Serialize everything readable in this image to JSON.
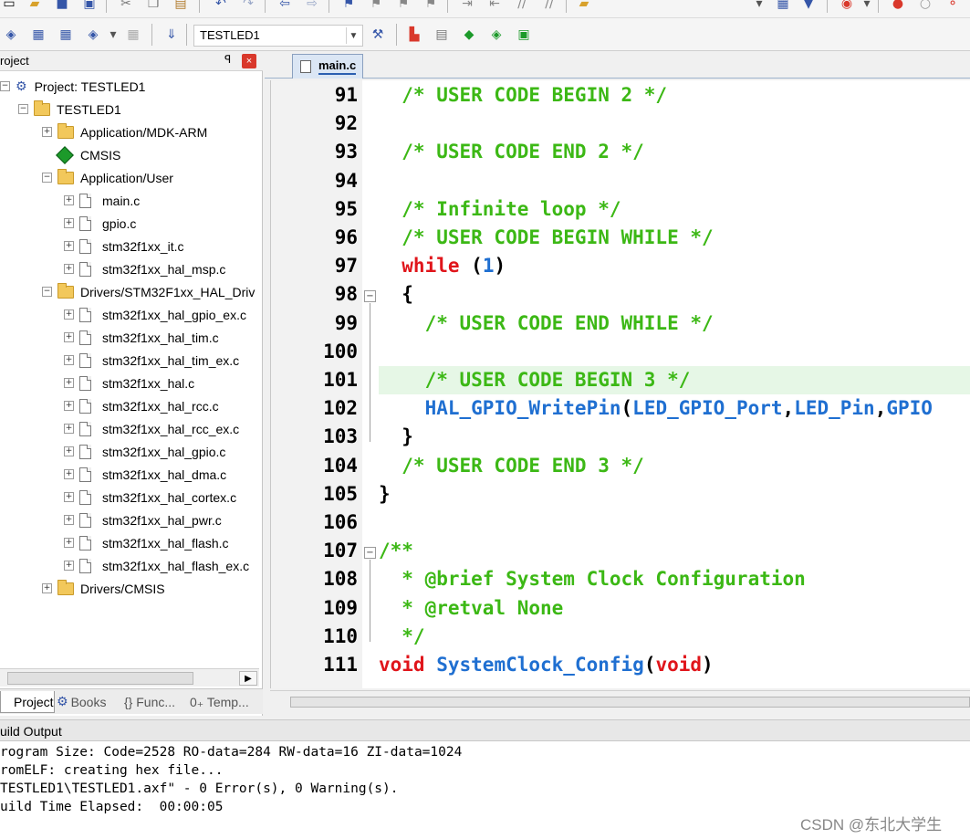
{
  "toolbar": {
    "target_name": "TESTLED1"
  },
  "project_panel": {
    "title": "roject",
    "pin_glyph": "ꟼ",
    "close_glyph": "×",
    "project_root": "Project: TESTLED1",
    "target": "TESTLED1",
    "groups": [
      {
        "label": "Application/MDK-ARM",
        "expander": "+"
      },
      {
        "label": "CMSIS"
      },
      {
        "label": "Application/User",
        "expander": "−"
      },
      {
        "label": "Drivers/STM32F1xx_HAL_Driv",
        "expander": "−"
      },
      {
        "label": "Drivers/CMSIS",
        "expander": "+"
      }
    ],
    "user_files": [
      "main.c",
      "gpio.c",
      "stm32f1xx_it.c",
      "stm32f1xx_hal_msp.c"
    ],
    "driver_files": [
      "stm32f1xx_hal_gpio_ex.c",
      "stm32f1xx_hal_tim.c",
      "stm32f1xx_hal_tim_ex.c",
      "stm32f1xx_hal.c",
      "stm32f1xx_hal_rcc.c",
      "stm32f1xx_hal_rcc_ex.c",
      "stm32f1xx_hal_gpio.c",
      "stm32f1xx_hal_dma.c",
      "stm32f1xx_hal_cortex.c",
      "stm32f1xx_hal_pwr.c",
      "stm32f1xx_hal_flash.c",
      "stm32f1xx_hal_flash_ex.c"
    ],
    "tabs": [
      "Project",
      "Books",
      "{} Func...",
      "0₊ Temp..."
    ]
  },
  "editor": {
    "active_tab": "main.c",
    "lines": [
      {
        "n": "91",
        "parts": [
          {
            "t": "  /* USER CODE BEGIN 2 */",
            "c": "comment"
          }
        ]
      },
      {
        "n": "92",
        "parts": []
      },
      {
        "n": "93",
        "parts": [
          {
            "t": "  /* USER CODE END 2 */",
            "c": "comment"
          }
        ]
      },
      {
        "n": "94",
        "parts": []
      },
      {
        "n": "95",
        "parts": [
          {
            "t": "  /* Infinite loop */",
            "c": "comment"
          }
        ]
      },
      {
        "n": "96",
        "parts": [
          {
            "t": "  /* USER CODE BEGIN WHILE */",
            "c": "comment"
          }
        ]
      },
      {
        "n": "97",
        "parts": [
          {
            "t": "  while",
            "c": "kw"
          },
          {
            "t": " (",
            "c": "plain"
          },
          {
            "t": "1",
            "c": "num"
          },
          {
            "t": ")",
            "c": "plain"
          }
        ]
      },
      {
        "n": "98",
        "parts": [
          {
            "t": "  {",
            "c": "plain"
          }
        ],
        "fold": "−"
      },
      {
        "n": "99",
        "parts": [
          {
            "t": "    /* USER CODE END WHILE */",
            "c": "comment"
          }
        ]
      },
      {
        "n": "100",
        "parts": []
      },
      {
        "n": "101",
        "parts": [
          {
            "t": "    /* USER CODE BEGIN 3 */",
            "c": "comment"
          }
        ],
        "highlight": true
      },
      {
        "n": "102",
        "parts": [
          {
            "t": "    HAL_GPIO_WritePin",
            "c": "fn"
          },
          {
            "t": "(",
            "c": "plain"
          },
          {
            "t": "LED_GPIO_Port",
            "c": "fn"
          },
          {
            "t": ",",
            "c": "plain"
          },
          {
            "t": "LED_Pin",
            "c": "fn"
          },
          {
            "t": ",",
            "c": "plain"
          },
          {
            "t": "GPIO",
            "c": "fn"
          }
        ]
      },
      {
        "n": "103",
        "parts": [
          {
            "t": "  }",
            "c": "plain"
          }
        ]
      },
      {
        "n": "104",
        "parts": [
          {
            "t": "  /* USER CODE END 3 */",
            "c": "comment"
          }
        ]
      },
      {
        "n": "105",
        "parts": [
          {
            "t": "}",
            "c": "plain"
          }
        ]
      },
      {
        "n": "106",
        "parts": []
      },
      {
        "n": "107",
        "parts": [
          {
            "t": "/**",
            "c": "comment"
          }
        ],
        "fold": "−"
      },
      {
        "n": "108",
        "parts": [
          {
            "t": "  * @brief System Clock Configuration",
            "c": "comment"
          }
        ]
      },
      {
        "n": "109",
        "parts": [
          {
            "t": "  * @retval None",
            "c": "comment"
          }
        ]
      },
      {
        "n": "110",
        "parts": [
          {
            "t": "  */",
            "c": "comment"
          }
        ]
      },
      {
        "n": "111",
        "parts": [
          {
            "t": "void",
            "c": "kw"
          },
          {
            "t": " ",
            "c": "plain"
          },
          {
            "t": "SystemClock_Config",
            "c": "fn"
          },
          {
            "t": "(",
            "c": "plain"
          },
          {
            "t": "void",
            "c": "kw"
          },
          {
            "t": ")",
            "c": "plain"
          }
        ]
      }
    ]
  },
  "build_output": {
    "title": "uild Output",
    "lines": [
      "rogram Size: Code=2528 RO-data=284 RW-data=16 ZI-data=1024",
      "romELF: creating hex file...",
      "TESTLED1\\TESTLED1.axf\" - 0 Error(s), 0 Warning(s).",
      "uild Time Elapsed:  00:00:05"
    ]
  },
  "watermark": "CSDN @东北大学生",
  "colors": {
    "comment": "#3cb815",
    "keyword": "#e0151b",
    "identifier": "#1f6fd1",
    "highlight_line": "#e6f7e6"
  }
}
